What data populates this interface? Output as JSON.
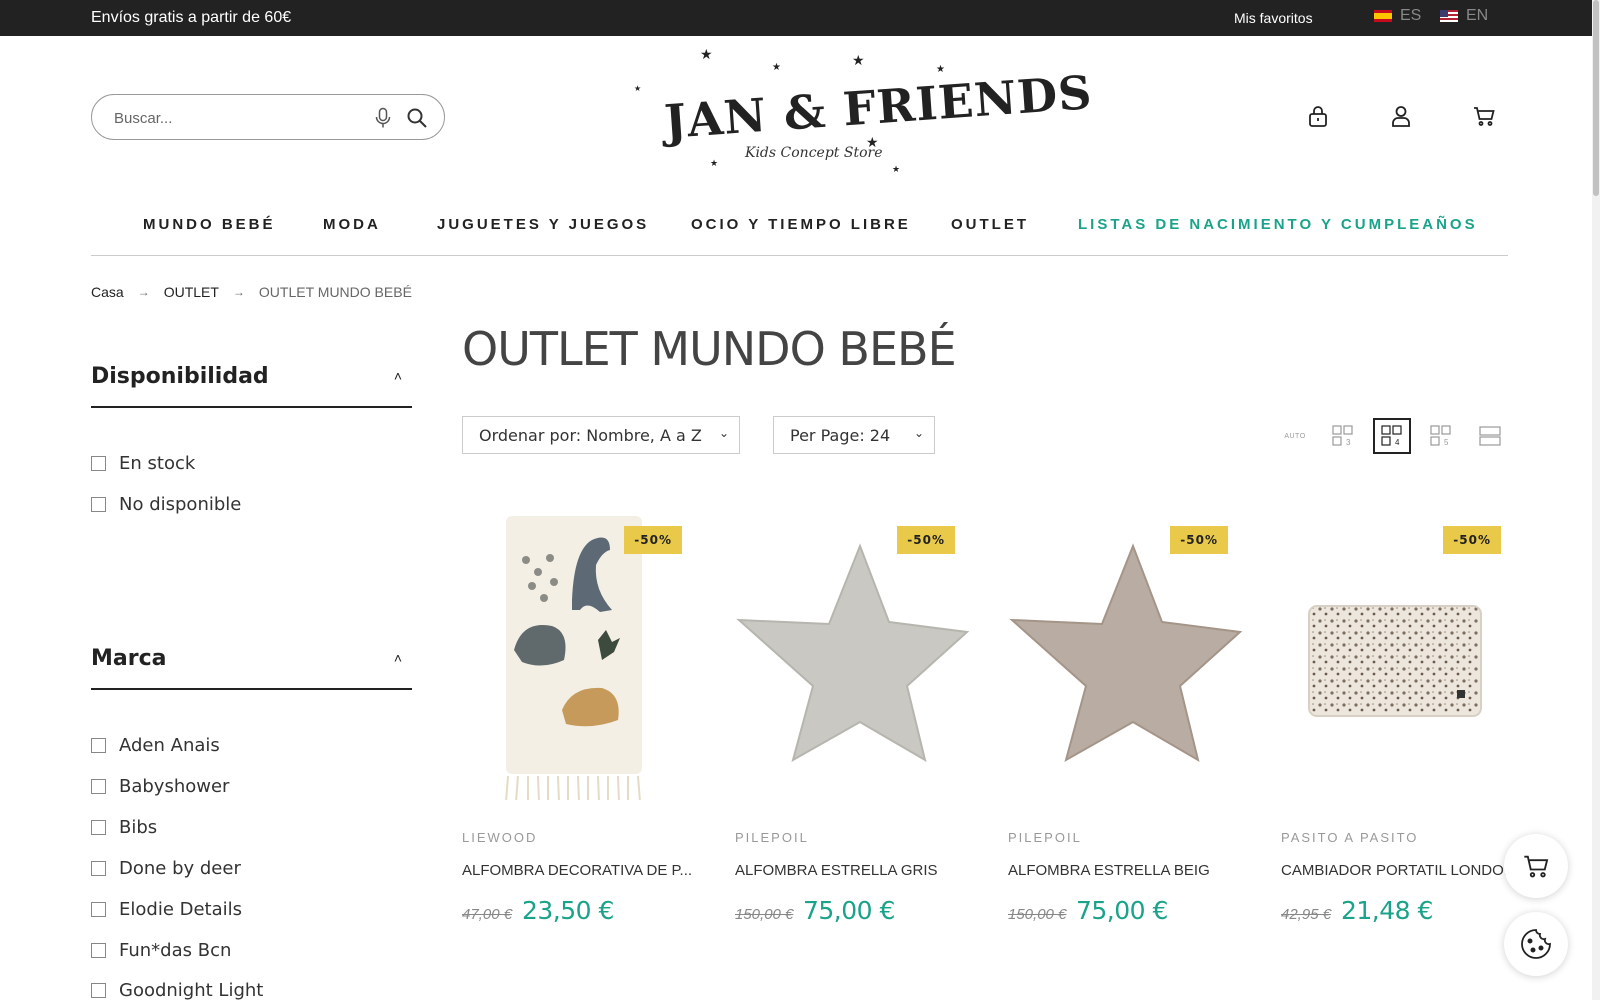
{
  "topbar": {
    "promo": "Envíos gratis a partir de 60€",
    "favorites": "Mis favoritos",
    "lang_es": "ES",
    "lang_en": "EN"
  },
  "search": {
    "placeholder": "Buscar..."
  },
  "logo": {
    "brand": "JAN & FRIENDS",
    "tagline": "Kids Concept Store"
  },
  "nav": {
    "items": [
      "MUNDO BEBÉ",
      "MODA",
      "JUGUETES Y JUEGOS",
      "OCIO Y TIEMPO LIBRE",
      "OUTLET",
      "LISTAS DE NACIMIENTO Y CUMPLEAÑOS"
    ],
    "accent_color": "#1aa38a"
  },
  "breadcrumb": {
    "home": "Casa",
    "level1": "OUTLET",
    "current": "OUTLET MUNDO BEBÉ",
    "separator": "→"
  },
  "filters": {
    "availability": {
      "title": "Disponibilidad",
      "options": [
        "En stock",
        "No disponible"
      ]
    },
    "brand": {
      "title": "Marca",
      "options": [
        "Aden Anais",
        "Babyshower",
        "Bibs",
        "Done by deer",
        "Elodie Details",
        "Fun*das Bcn",
        "Goodnight Light"
      ]
    }
  },
  "main": {
    "title": "OUTLET MUNDO BEBÉ",
    "sort": "Ordenar por: Nombre, A a Z",
    "per_page": "Per Page: 24",
    "view_auto": "AUTO",
    "view_3": "3",
    "view_4": "4",
    "view_5": "5"
  },
  "products": [
    {
      "brand": "LIEWOOD",
      "name": "ALFOMBRA DECORATIVA DE P...",
      "old_price": "47,00 €",
      "price": "23,50 €",
      "badge": "-50%"
    },
    {
      "brand": "PILEPOIL",
      "name": "ALFOMBRA ESTRELLA GRIS",
      "old_price": "150,00 €",
      "price": "75,00 €",
      "badge": "-50%"
    },
    {
      "brand": "PILEPOIL",
      "name": "ALFOMBRA ESTRELLA BEIG",
      "old_price": "150,00 €",
      "price": "75,00 €",
      "badge": "-50%"
    },
    {
      "brand": "PASITO A PASITO",
      "name": "CAMBIADOR PORTATIL LONDO...",
      "old_price": "42,95 €",
      "price": "21,48 €",
      "badge": "-50%"
    }
  ],
  "colors": {
    "topbar": "#222222",
    "badge": "#e8c94a",
    "price": "#1aa38a"
  },
  "icons": [
    "microphone-icon",
    "search-icon",
    "lock-icon",
    "user-icon",
    "cart-icon",
    "cookie-icon"
  ]
}
